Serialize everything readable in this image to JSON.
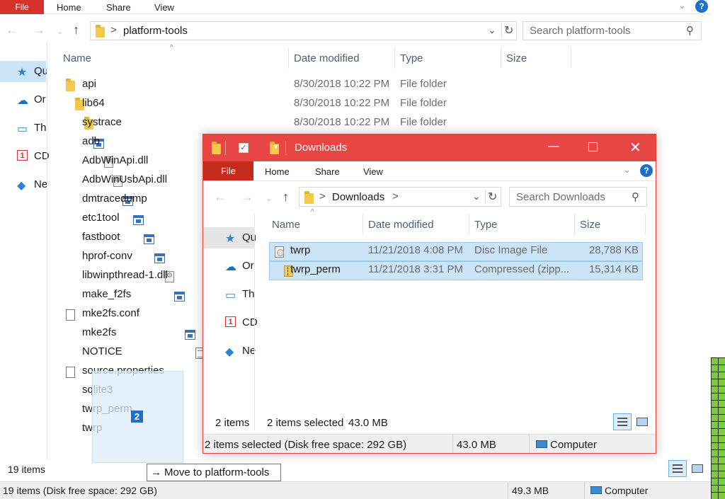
{
  "main_window": {
    "ribbon": {
      "file": "File",
      "home": "Home",
      "share": "Share",
      "view": "View"
    },
    "address": {
      "crumb_sep": ">",
      "location": "platform-tools"
    },
    "search": {
      "placeholder": "Search platform-tools"
    },
    "columns": {
      "name": "Name",
      "date": "Date modified",
      "type": "Type",
      "size": "Size"
    },
    "sidebar": [
      {
        "label": "Qu",
        "icon": "star-icon"
      },
      {
        "label": "Or",
        "icon": "onedrive-icon"
      },
      {
        "label": "Th",
        "icon": "computer-icon"
      },
      {
        "label": "CD",
        "icon": "oneplus-icon"
      },
      {
        "label": "Ne",
        "icon": "network-icon"
      }
    ],
    "files": [
      {
        "name": "api",
        "date": "8/30/2018 10:22 PM",
        "type": "File folder",
        "icon": "folder"
      },
      {
        "name": "lib64",
        "date": "8/30/2018 10:22 PM",
        "type": "File folder",
        "icon": "folder"
      },
      {
        "name": "systrace",
        "date": "8/30/2018 10:22 PM",
        "type": "File folder",
        "icon": "folder"
      },
      {
        "name": "adb",
        "date": "",
        "type": "",
        "icon": "exe"
      },
      {
        "name": "AdbWinApi.dll",
        "date": "",
        "type": "",
        "icon": "dll"
      },
      {
        "name": "AdbWinUsbApi.dll",
        "date": "",
        "type": "",
        "icon": "dll"
      },
      {
        "name": "dmtracedump",
        "date": "",
        "type": "",
        "icon": "exe"
      },
      {
        "name": "etc1tool",
        "date": "",
        "type": "",
        "icon": "exe"
      },
      {
        "name": "fastboot",
        "date": "",
        "type": "",
        "icon": "exe"
      },
      {
        "name": "hprof-conv",
        "date": "",
        "type": "",
        "icon": "exe"
      },
      {
        "name": "libwinpthread-1.dll",
        "date": "",
        "type": "",
        "icon": "dll"
      },
      {
        "name": "make_f2fs",
        "date": "",
        "type": "",
        "icon": "exe"
      },
      {
        "name": "mke2fs.conf",
        "date": "",
        "type": "",
        "icon": "file"
      },
      {
        "name": "mke2fs",
        "date": "",
        "type": "",
        "icon": "exe"
      },
      {
        "name": "NOTICE",
        "date": "",
        "type": "",
        "icon": "txt"
      },
      {
        "name": "source.properties",
        "date": "",
        "type": "",
        "icon": "file"
      },
      {
        "name": "sqlite3",
        "date": "",
        "type": "",
        "icon": "exe"
      },
      {
        "name": "twrp_perm",
        "date": "",
        "type": "",
        "icon": "zip"
      },
      {
        "name": "twrp",
        "date": "",
        "type": "",
        "icon": "iso"
      }
    ],
    "status_items": "19 items",
    "bottom_status": {
      "left": "19 items (Disk free space: 292 GB)",
      "size": "49.3 MB",
      "location": "Computer"
    }
  },
  "drag": {
    "count": "2",
    "tooltip_arrow": "→",
    "tooltip": "Move to platform-tools"
  },
  "downloads_window": {
    "title": "Downloads",
    "ribbon": {
      "file": "File",
      "home": "Home",
      "share": "Share",
      "view": "View"
    },
    "address": {
      "crumb_sep": ">",
      "location": "Downloads"
    },
    "search": {
      "placeholder": "Search Downloads"
    },
    "columns": {
      "name": "Name",
      "date": "Date modified",
      "type": "Type",
      "size": "Size"
    },
    "sidebar": [
      {
        "label": "Qu",
        "icon": "star-icon"
      },
      {
        "label": "Or",
        "icon": "onedrive-icon"
      },
      {
        "label": "Th",
        "icon": "computer-icon"
      },
      {
        "label": "CD",
        "icon": "oneplus-icon"
      },
      {
        "label": "Ne",
        "icon": "network-icon"
      }
    ],
    "files": [
      {
        "name": "twrp",
        "date": "11/21/2018 4:08 PM",
        "type": "Disc Image File",
        "size": "28,788 KB",
        "icon": "iso",
        "selected": true
      },
      {
        "name": "twrp_perm",
        "date": "11/21/2018 3:31 PM",
        "type": "Compressed (zipp...",
        "size": "15,314 KB",
        "icon": "zip",
        "selected": true
      }
    ],
    "status": {
      "items": "2 items",
      "selected": "2 items selected",
      "selected_size": "43.0 MB"
    },
    "bottom_status": {
      "left": "2 items selected (Disk free space: 292 GB)",
      "size": "43.0 MB",
      "location": "Computer"
    }
  },
  "colors": {
    "accent_red": "#e84545",
    "file_tab": "#c42b1c",
    "selection": "#cce4f7",
    "help_blue": "#1c6fd1"
  }
}
